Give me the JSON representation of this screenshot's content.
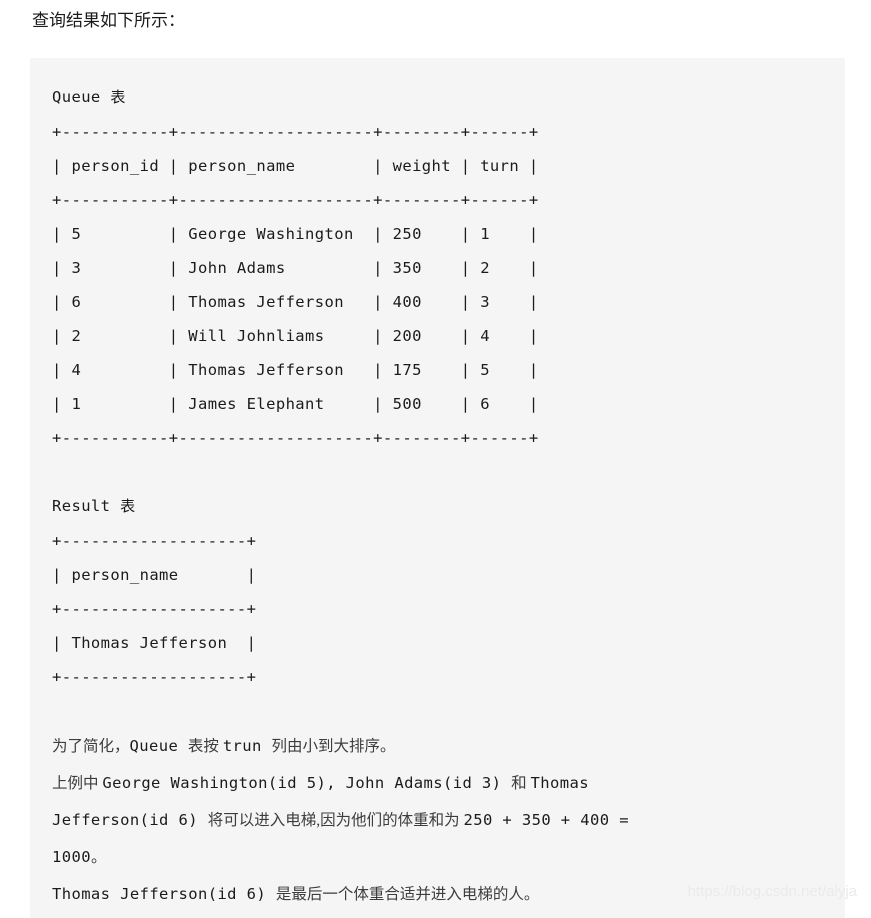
{
  "page": {
    "title": "查询结果如下所示：",
    "background_color": "#ffffff",
    "code_block_color": "#f5f5f5",
    "text_color": "#1b1b1b"
  },
  "queue_table": {
    "label_latin": "Queue ",
    "label_cjk": "表",
    "columns": [
      "person_id",
      "person_name",
      "weight",
      "turn"
    ],
    "rows": [
      {
        "person_id": "5",
        "person_name": "George Washington",
        "weight": "250",
        "turn": "1"
      },
      {
        "person_id": "3",
        "person_name": "John Adams",
        "weight": "350",
        "turn": "2"
      },
      {
        "person_id": "6",
        "person_name": "Thomas Jefferson",
        "weight": "400",
        "turn": "3"
      },
      {
        "person_id": "2",
        "person_name": "Will Johnliams",
        "weight": "200",
        "turn": "4"
      },
      {
        "person_id": "4",
        "person_name": "Thomas Jefferson",
        "weight": "175",
        "turn": "5"
      },
      {
        "person_id": "1",
        "person_name": "James Elephant",
        "weight": "500",
        "turn": "6"
      }
    ],
    "ascii": {
      "separator": "+-----------+--------------------+--------+------+",
      "header": "| person_id | person_name        | weight | turn |",
      "row_0": "| 5         | George Washington  | 250    | 1    |",
      "row_1": "| 3         | John Adams         | 350    | 2    |",
      "row_2": "| 6         | Thomas Jefferson   | 400    | 3    |",
      "row_3": "| 2         | Will Johnliams     | 200    | 4    |",
      "row_4": "| 4         | Thomas Jefferson   | 175    | 5    |",
      "row_5": "| 1         | James Elephant     | 500    | 6    |"
    }
  },
  "result_table": {
    "label_latin": "Result ",
    "label_cjk": "表",
    "columns": [
      "person_name"
    ],
    "rows": [
      {
        "person_name": "Thomas Jefferson"
      }
    ],
    "ascii": {
      "separator": "+-------------------+",
      "header": "| person_name       |",
      "row_0": "| Thomas Jefferson  |"
    }
  },
  "notes": [
    {
      "segments": [
        {
          "text": "为了简化，",
          "script": "cjk"
        },
        {
          "text": "Queue ",
          "script": "mono"
        },
        {
          "text": "表按 ",
          "script": "cjk"
        },
        {
          "text": "trun ",
          "script": "mono"
        },
        {
          "text": "列由小到大排序。",
          "script": "cjk"
        }
      ]
    },
    {
      "segments": [
        {
          "text": "上例中 ",
          "script": "cjk"
        },
        {
          "text": "George Washington(id 5), John Adams(id 3) ",
          "script": "mono"
        },
        {
          "text": "和 ",
          "script": "cjk"
        },
        {
          "text": "Thomas",
          "script": "mono"
        }
      ]
    },
    {
      "segments": [
        {
          "text": "Jefferson(id 6) ",
          "script": "mono"
        },
        {
          "text": "将可以进入电梯,因为他们的体重和为 ",
          "script": "cjk"
        },
        {
          "text": "250 + 350 + 400 =",
          "script": "mono"
        }
      ]
    },
    {
      "segments": [
        {
          "text": "1000",
          "script": "mono"
        },
        {
          "text": "。",
          "script": "cjk"
        }
      ]
    },
    {
      "segments": [
        {
          "text": "Thomas Jefferson(id 6) ",
          "script": "mono"
        },
        {
          "text": "是最后一个体重合适并进入电梯的人。",
          "script": "cjk"
        }
      ]
    }
  ],
  "watermark": {
    "text": "https://blog.csdn.net/alyja"
  }
}
